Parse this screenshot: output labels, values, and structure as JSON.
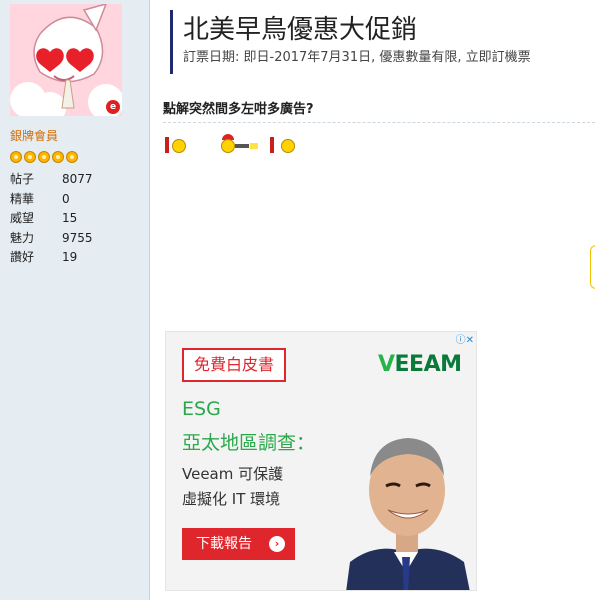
{
  "post": {
    "title": "北美早鳥優惠大促銷",
    "subtitle": "訂票日期: 即日-2017年7月31日, 優惠數量有限, 立即訂機票"
  },
  "author": {
    "rank": "銀牌會員",
    "star_count": 5,
    "stats": [
      {
        "label": "帖子",
        "value": "8077"
      },
      {
        "label": "精華",
        "value": "0"
      },
      {
        "label": "威望",
        "value": "15"
      },
      {
        "label": "魅力",
        "value": "9755"
      },
      {
        "label": "讚好",
        "value": "19"
      }
    ],
    "avatar_badge": "e"
  },
  "reply": {
    "question": "點解突然間多左咁多廣告?"
  },
  "ad": {
    "badge": "免費白皮書",
    "logo": "veeam",
    "esg": "ESG",
    "survey": "亞太地區調查：",
    "line1": "Veeam 可保護",
    "line2": "虛擬化 IT 環境",
    "cta": "下載報告",
    "accent_color": "#e0262d",
    "green_color": "#2aa84a"
  }
}
